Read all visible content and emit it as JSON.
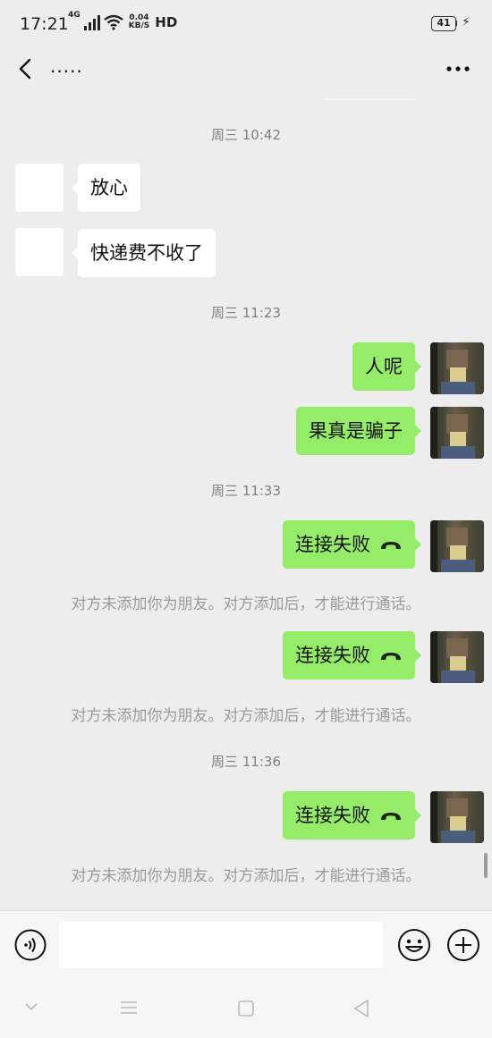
{
  "status_bar": {
    "time": "17:21",
    "network_type": "4G",
    "speed_value": "0.04",
    "speed_unit": "KB/S",
    "hd_label": "HD",
    "battery": "41"
  },
  "header": {
    "title": ".....",
    "back_icon": "chevron-left-icon",
    "more_icon": "more-dots-icon"
  },
  "messages": {
    "time_1": "周三 10:42",
    "in_1": "放心",
    "in_2": "快递费不收了",
    "time_2": "周三 11:23",
    "out_1": "人呢",
    "out_2": "果真是骗子",
    "time_3": "周三 11:33",
    "call_1": "连接失败",
    "sys_1": "对方未添加你为朋友。对方添加后，才能进行通话。",
    "call_2": "连接失败",
    "sys_2": "对方未添加你为朋友。对方添加后，才能进行通话。",
    "time_4": "周三 11:36",
    "call_3": "连接失败",
    "sys_3": "对方未添加你为朋友。对方添加后，才能进行通话。"
  },
  "input_bar": {
    "value": "",
    "voice_icon": "voice-icon",
    "emoji_icon": "emoji-icon",
    "plus_icon": "plus-icon"
  },
  "colors": {
    "background": "#ededed",
    "outgoing_bubble": "#95ec69",
    "incoming_bubble": "#ffffff",
    "time_text": "#808080",
    "system_text": "#9a9a9a"
  }
}
